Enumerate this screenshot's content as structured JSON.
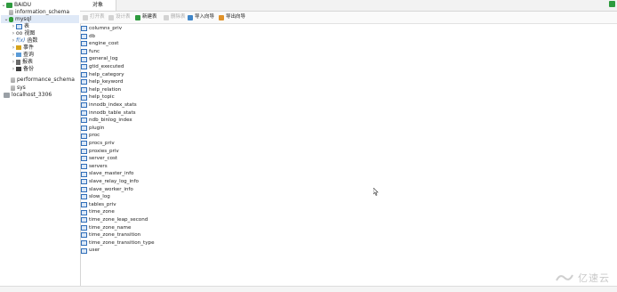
{
  "navigator": {
    "connection1": "BAIDU",
    "databases": [
      {
        "name": "information_schema"
      },
      {
        "name": "mysql"
      }
    ],
    "mysql_children": [
      {
        "label": "表",
        "icon": "table-icon"
      },
      {
        "label": "视图",
        "icon": "view-icon"
      },
      {
        "label": "函数",
        "icon": "function-icon"
      },
      {
        "label": "事件",
        "icon": "event-icon"
      },
      {
        "label": "查询",
        "icon": "query-icon"
      },
      {
        "label": "报表",
        "icon": "report-icon"
      },
      {
        "label": "备份",
        "icon": "backup-icon"
      }
    ],
    "other_databases": [
      {
        "name": "performance_schema"
      },
      {
        "name": "sys"
      }
    ],
    "connection2": "localhost_3306"
  },
  "tabbar": {
    "tab_label": "对象"
  },
  "toolbar": {
    "open_table": "打开表",
    "design_table": "设计表",
    "new_table": "新建表",
    "delete_table": "删除表",
    "import_wizard": "导入向导",
    "export_wizard": "导出向导"
  },
  "tables": [
    "columns_priv",
    "db",
    "engine_cost",
    "func",
    "general_log",
    "gtid_executed",
    "help_category",
    "help_keyword",
    "help_relation",
    "help_topic",
    "innodb_index_stats",
    "innodb_table_stats",
    "ndb_binlog_index",
    "plugin",
    "proc",
    "procs_priv",
    "proxies_priv",
    "server_cost",
    "servers",
    "slave_master_info",
    "slave_relay_log_info",
    "slave_worker_info",
    "slow_log",
    "tables_priv",
    "time_zone",
    "time_zone_leap_second",
    "time_zone_name",
    "time_zone_transition",
    "time_zone_transition_type",
    "user"
  ],
  "watermark": {
    "text": "亿速云"
  },
  "colors": {
    "accent": "#2e9a3e",
    "table_icon": "#2f6db8"
  }
}
